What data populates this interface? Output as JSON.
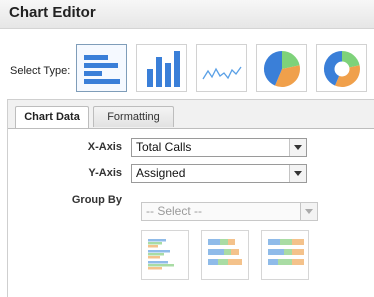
{
  "header": {
    "title": "Chart Editor"
  },
  "chart_types": {
    "label": "Select Type:",
    "options": [
      {
        "name": "horizontal-bar",
        "selected": true
      },
      {
        "name": "vertical-bar",
        "selected": false
      },
      {
        "name": "line",
        "selected": false
      },
      {
        "name": "pie",
        "selected": false
      },
      {
        "name": "donut",
        "selected": false
      }
    ]
  },
  "tabs": [
    {
      "label": "Chart Data",
      "active": true
    },
    {
      "label": "Formatting",
      "active": false
    }
  ],
  "fields": {
    "x_axis": {
      "label": "X-Axis",
      "value": "Total Calls"
    },
    "y_axis": {
      "label": "Y-Axis",
      "value": "Assigned"
    },
    "group_by": {
      "label": "Group By",
      "value": "-- Select --",
      "disabled": true
    }
  },
  "group_layouts": [
    "grouped-bars",
    "stacked-bars",
    "full-stacked-bars"
  ],
  "colors": {
    "blue": "#3a7fd8",
    "green": "#7ed27a",
    "orange": "#f0a04b",
    "selected_border": "#7f9db9"
  }
}
